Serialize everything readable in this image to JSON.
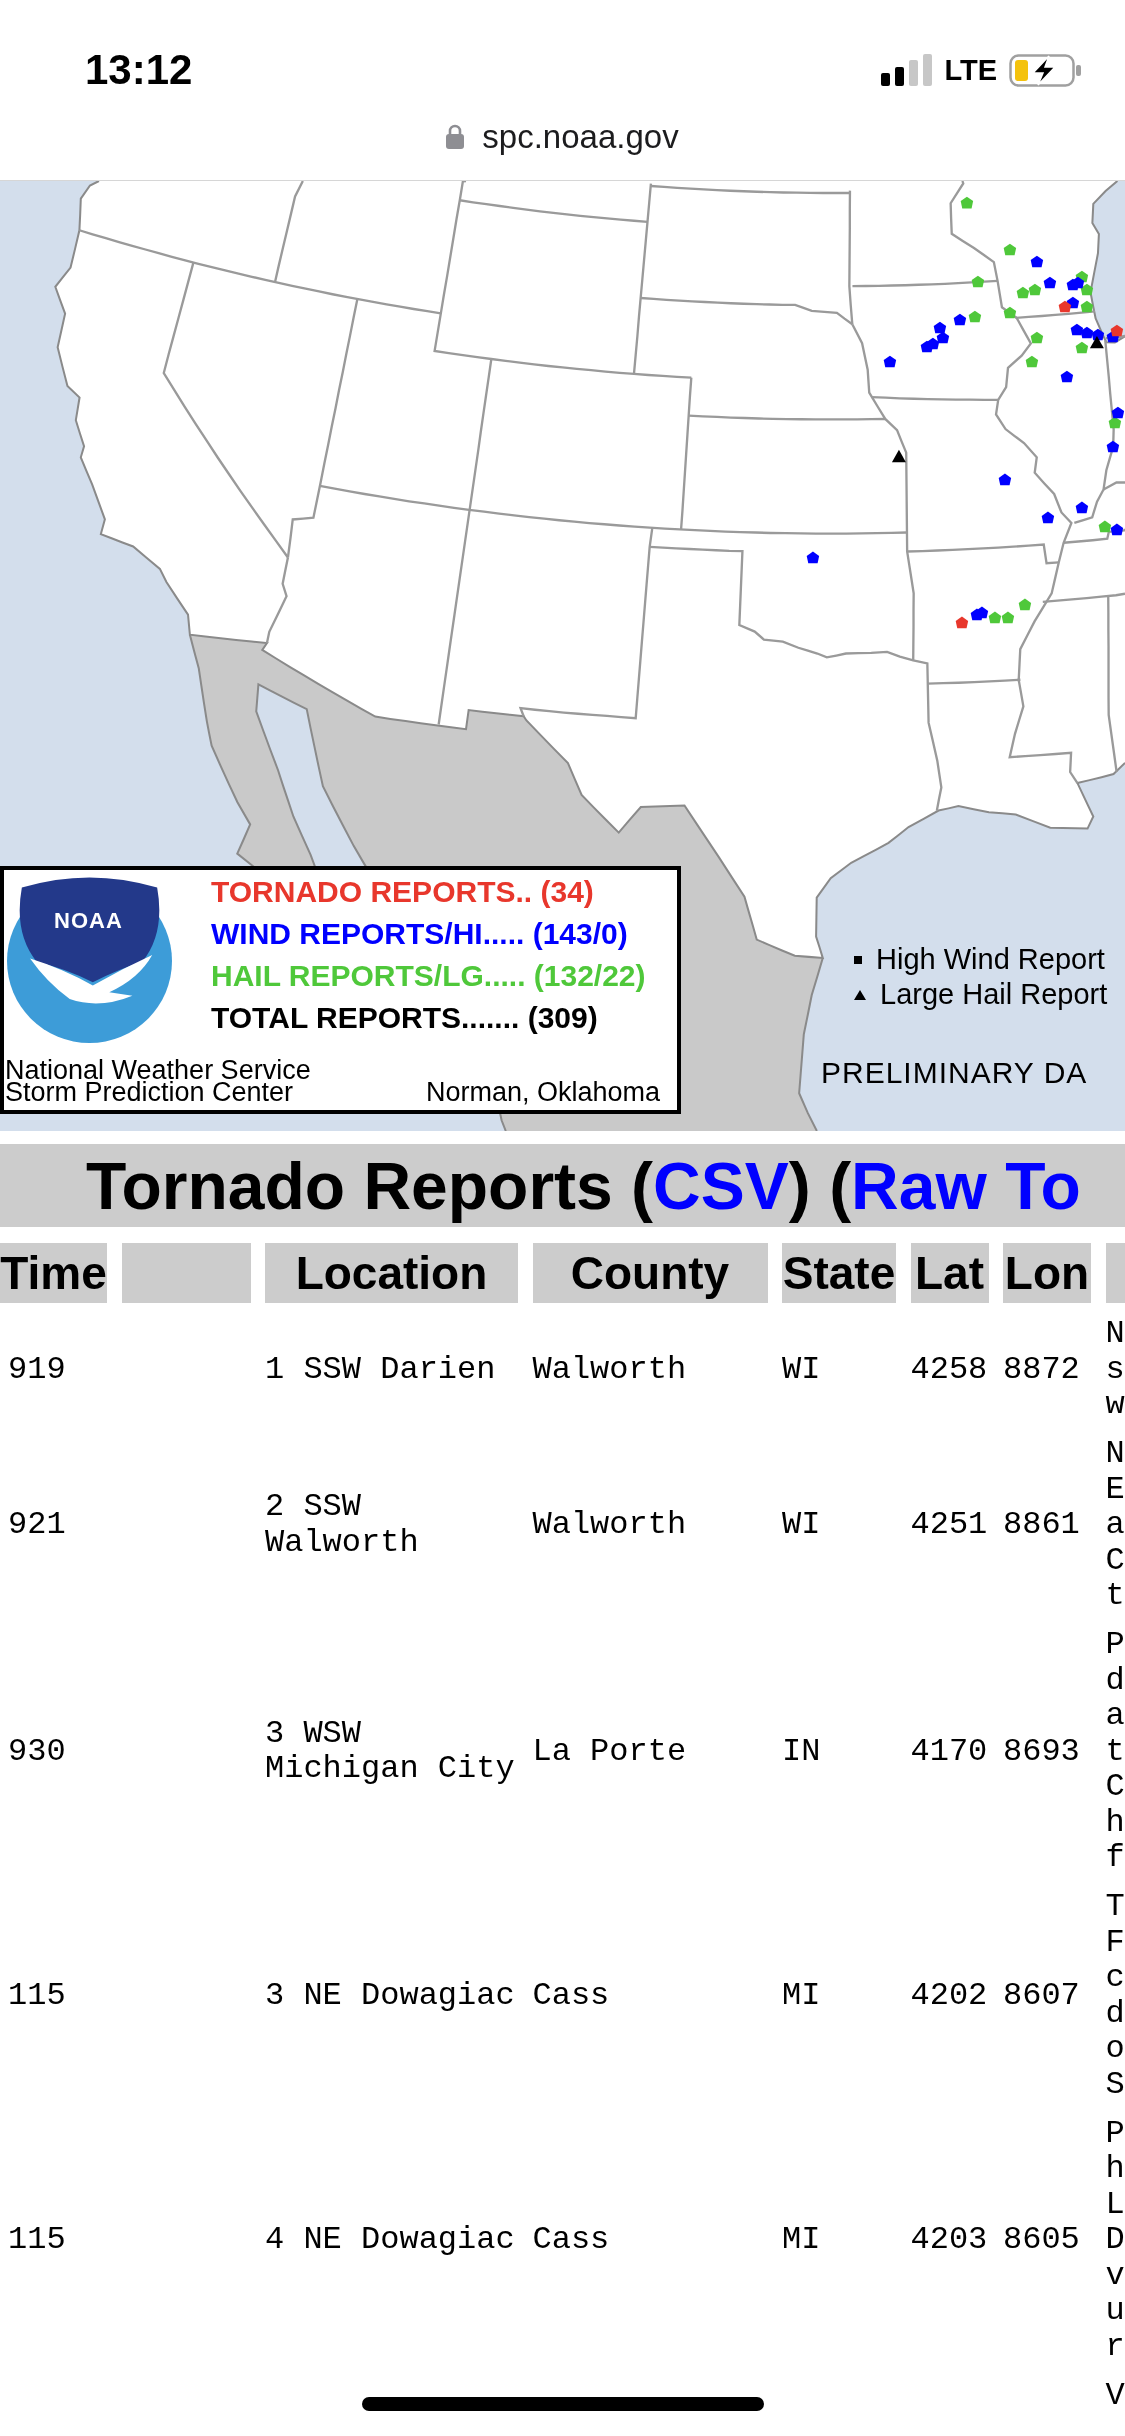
{
  "status_bar": {
    "time": "13:12",
    "network": "LTE"
  },
  "address_bar": {
    "url": "spc.noaa.gov"
  },
  "map": {
    "logo_text": "NOAA",
    "summary": [
      {
        "kind": "tornado",
        "text": "TORNADO REPORTS.. (34)",
        "color": "#e8372c"
      },
      {
        "kind": "wind",
        "text": "WIND REPORTS/HI..... (143/0)",
        "color": "#0000ff"
      },
      {
        "kind": "hail",
        "text": "HAIL REPORTS/LG..... (132/22)",
        "color": "#4fc83a"
      },
      {
        "kind": "total",
        "text": "TOTAL REPORTS....... (309)",
        "color": "#000000"
      }
    ],
    "credits": [
      "National Weather Service",
      "Storm Prediction Center"
    ],
    "credit_location": "Norman, Oklahoma",
    "key": [
      {
        "kind": "square",
        "label": "High Wind Report"
      },
      {
        "kind": "triangle",
        "label": "Large Hail Report"
      }
    ],
    "banner": "PRELIMINARY DA"
  },
  "table": {
    "title": [
      {
        "kind": "text",
        "text": "Tornado Reports ("
      },
      {
        "kind": "link",
        "text": "CSV"
      },
      {
        "kind": "text",
        "text": ") ("
      },
      {
        "kind": "link",
        "text": "Raw To"
      }
    ],
    "columns": [
      {
        "kind": "time",
        "label": "Time"
      },
      {
        "kind": "blank"
      },
      {
        "kind": "location",
        "label": "Location"
      },
      {
        "kind": "county",
        "label": "County"
      },
      {
        "kind": "state",
        "label": "State"
      },
      {
        "kind": "lat",
        "label": "Lat"
      },
      {
        "kind": "lon",
        "label": "Lon"
      },
      {
        "kind": "remarks"
      }
    ],
    "rows": [
      {
        "time": "919",
        "location": "1 SSW Darien",
        "county": "Walworth",
        "state": "WI",
        "lat": "4258",
        "lon": "8872",
        "remarks": [
          "N",
          "s",
          "w"
        ]
      },
      {
        "time": "921",
        "location": "2 SSW Walworth",
        "county": "Walworth",
        "state": "WI",
        "lat": "4251",
        "lon": "8861",
        "remarks": [
          "N",
          "E",
          "a",
          "C",
          "t"
        ]
      },
      {
        "time": "930",
        "location": "3 WSW Michigan City",
        "county": "La Porte",
        "state": "IN",
        "lat": "4170",
        "lon": "8693",
        "remarks": [
          "P",
          "d",
          "a",
          "t",
          "C",
          "h",
          "f"
        ]
      },
      {
        "time": "115",
        "location": "3 NE Dowagiac",
        "county": "Cass",
        "state": "MI",
        "lat": "4202",
        "lon": "8607",
        "remarks": [
          "T",
          "F",
          "c",
          "d",
          "o",
          "S"
        ]
      },
      {
        "time": "115",
        "location": "4 NE Dowagiac",
        "county": "Cass",
        "state": "MI",
        "lat": "4203",
        "lon": "8605",
        "remarks": [
          "P",
          "h",
          "L",
          "D",
          "v",
          "u",
          "r"
        ]
      },
      {
        "remarks": [
          "V"
        ]
      }
    ]
  }
}
